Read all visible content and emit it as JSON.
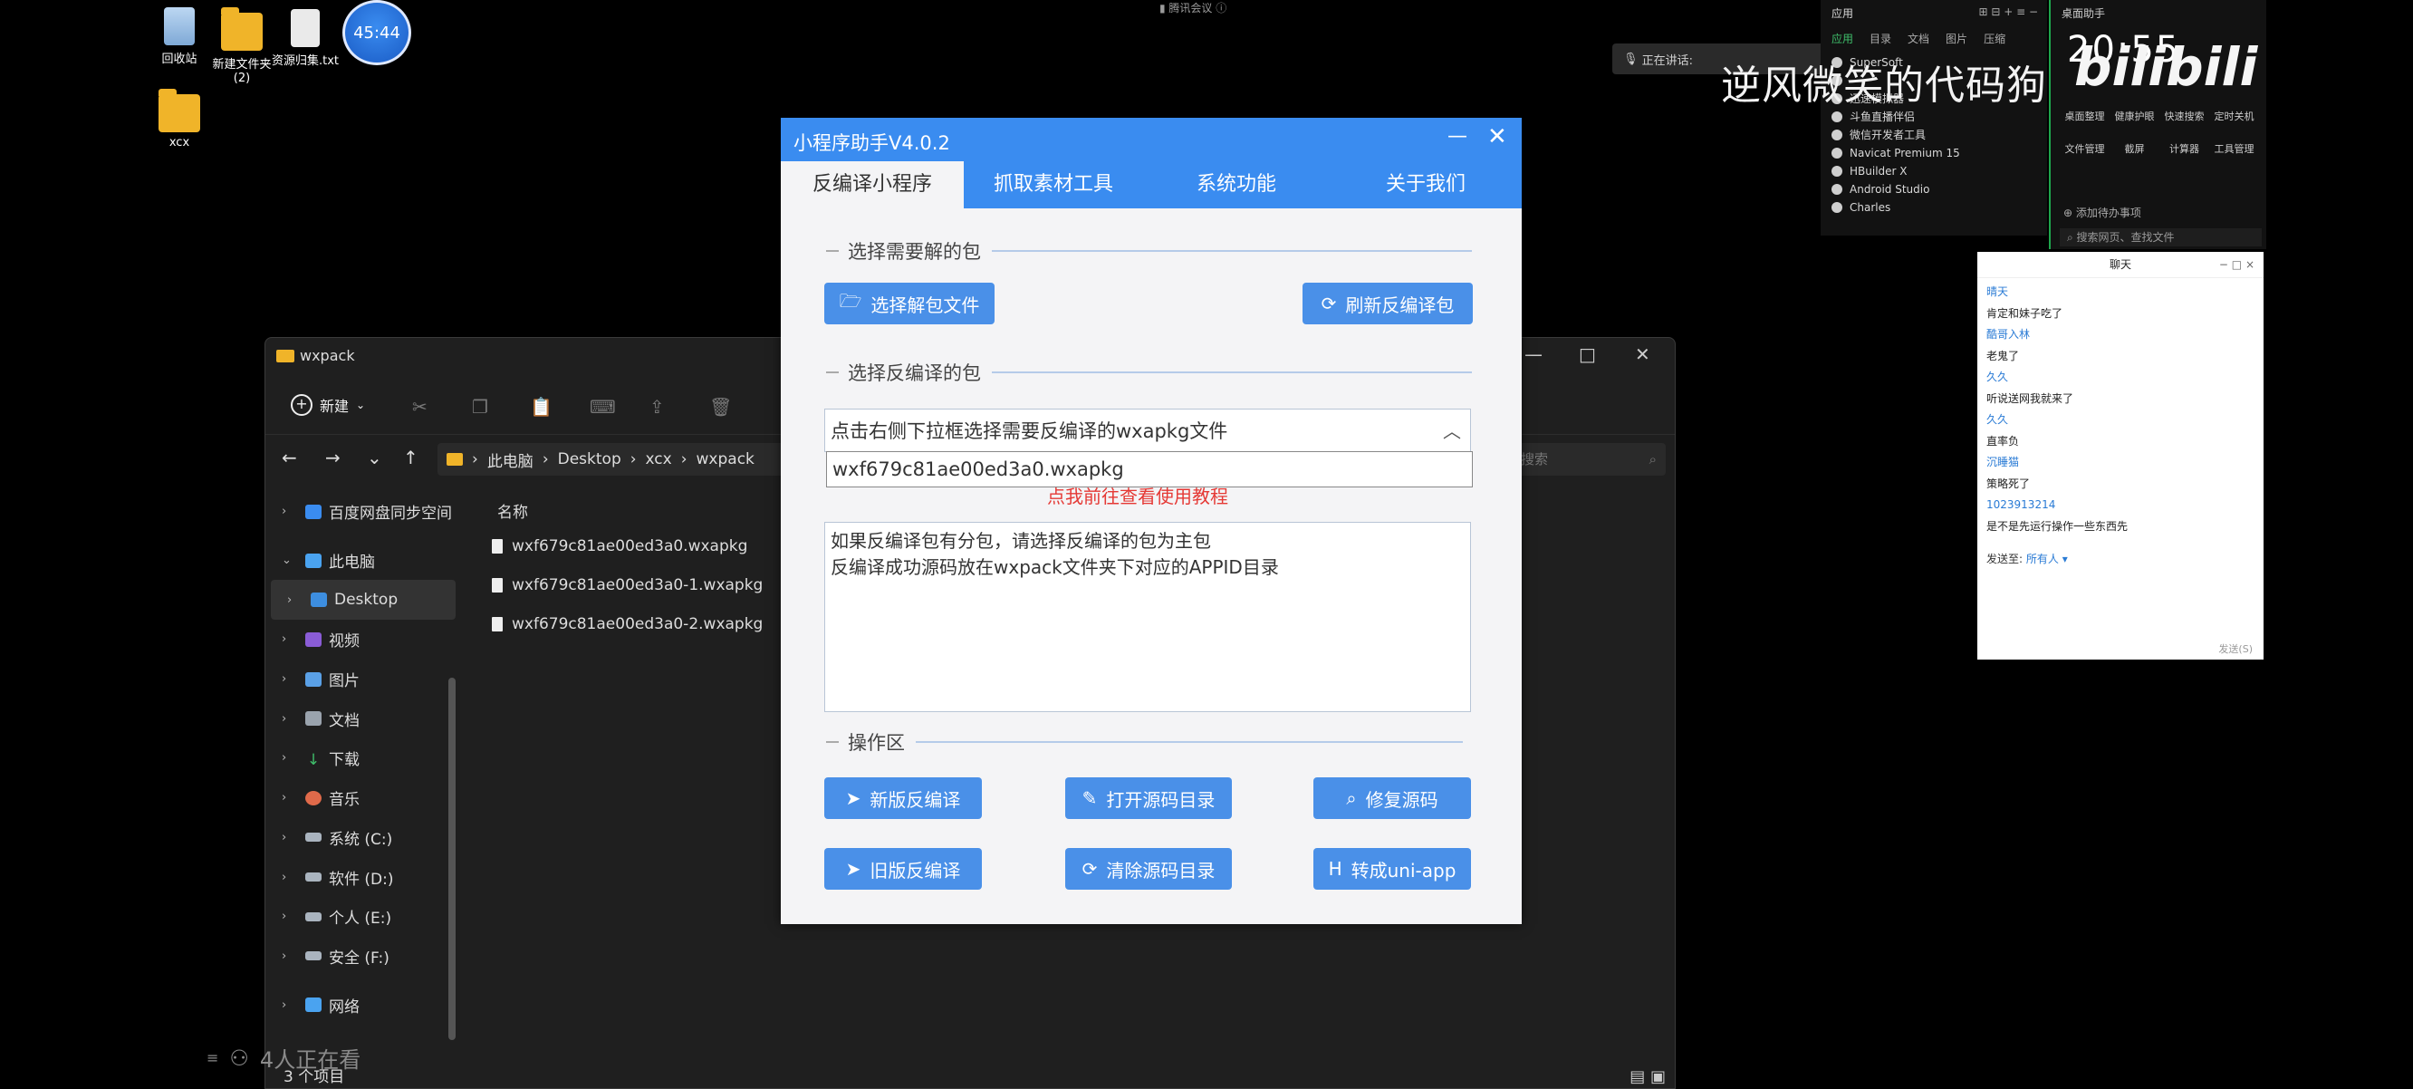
{
  "desktop": {
    "icons": [
      {
        "label": "回收站"
      },
      {
        "label": "新建文件夹\n(2)"
      },
      {
        "label": "资源归集.txt"
      },
      {
        "label": "xcx"
      }
    ],
    "clock_badge": "45:44"
  },
  "meeting_indicator": "腾讯会议",
  "speaking_status": "正在讲话:",
  "watermark": "逆风微笑的代码狗",
  "bilibili_logo": "bilibili",
  "time_display": "20:55",
  "launcher": {
    "title": "应用",
    "tabs": [
      "应用",
      "目录",
      "文档",
      "图片",
      "压缩"
    ],
    "apps": [
      "SuperSoft",
      "",
      "迅速模拟器",
      "斗鱼直播伴侣",
      "微信开发者工具",
      "Navicat Premium 15",
      "HBuilder X",
      "Android Studio",
      "Charles"
    ]
  },
  "desk_helper": {
    "title": "桌面助手",
    "actions": [
      "桌面整理",
      "健康护眼",
      "快速搜索",
      "定时关机",
      "文件管理",
      "截屏",
      "计算器",
      "工具管理"
    ],
    "todo": "添加待办事项",
    "search_placeholder": "搜索网页、查找文件"
  },
  "chat": {
    "title": "聊天",
    "messages": [
      {
        "name": "晴天",
        "text": "肯定和妹子吃了"
      },
      {
        "name": "酷哥入林",
        "text": "老鬼了"
      },
      {
        "name": "久久",
        "text": "听说送网我就来了"
      },
      {
        "name": "久久",
        "text": "直率负"
      },
      {
        "name": "沉睡猫",
        "text": "策略死了"
      },
      {
        "name": "1023913214",
        "text": "是不是先运行操作一些东西先"
      }
    ],
    "send_to_label": "发送至:",
    "send_to_value": "所有人",
    "send_button": "发送(S)"
  },
  "explorer": {
    "title": "wxpack",
    "new_label": "新建",
    "breadcrumb": [
      "此电脑",
      "Desktop",
      "xcx",
      "wxpack"
    ],
    "search_placeholder": "搜索",
    "sidebar": [
      {
        "label": "百度网盘同步空间"
      },
      {
        "label": "此电脑"
      },
      {
        "label": "Desktop"
      },
      {
        "label": "视频"
      },
      {
        "label": "图片"
      },
      {
        "label": "文档"
      },
      {
        "label": "下载"
      },
      {
        "label": "音乐"
      },
      {
        "label": "系统 (C:)"
      },
      {
        "label": "软件 (D:)"
      },
      {
        "label": "个人 (E:)"
      },
      {
        "label": "安全 (F:)"
      },
      {
        "label": "网络"
      }
    ],
    "column_name": "名称",
    "files": [
      "wxf679c81ae00ed3a0.wxapkg",
      "wxf679c81ae00ed3a0-1.wxapkg",
      "wxf679c81ae00ed3a0-2.wxapkg"
    ],
    "status": "3 个项目"
  },
  "viewers": "4人正在看",
  "dialog": {
    "title": "小程序助手V4.0.2",
    "tabs": [
      "反编译小程序",
      "抓取素材工具",
      "系统功能",
      "关于我们"
    ],
    "section_package": "选择需要解的包",
    "btn_select_file": "选择解包文件",
    "btn_refresh": "刷新反编译包",
    "section_decompile": "选择反编译的包",
    "select_text": "点击右侧下拉框选择需要反编译的wxapkg文件",
    "dropdown_option": "wxf679c81ae00ed3a0.wxapkg",
    "tutorial_link": "点我前往查看使用教程",
    "info_line1": "如果反编译包有分包，请选择反编译的包为主包",
    "info_line2": "反编译成功源码放在wxpack文件夹下对应的APPID目录",
    "section_ops": "操作区",
    "btn_new_decompile": "新版反编译",
    "btn_open_source": "打开源码目录",
    "btn_fix_source": "修复源码",
    "btn_old_decompile": "旧版反编译",
    "btn_clear_source": "清除源码目录",
    "btn_uniapp": "转成uni-app"
  }
}
